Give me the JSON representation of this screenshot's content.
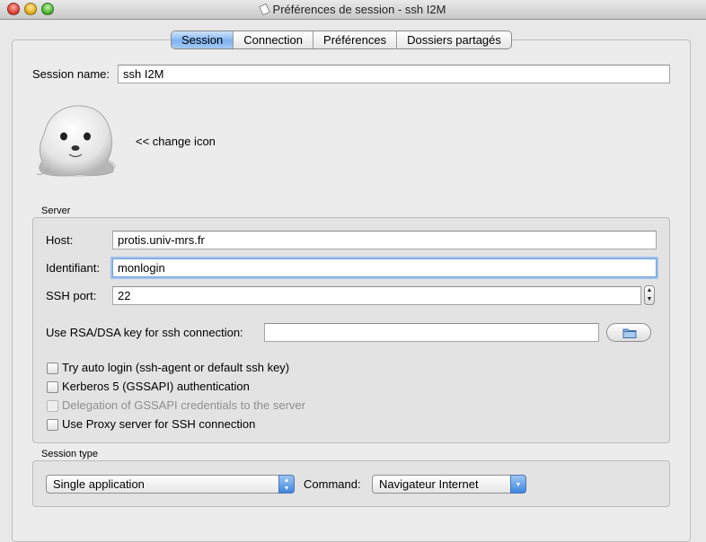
{
  "window": {
    "title": "Préférences de session - ssh I2M"
  },
  "tabs": [
    {
      "label": "Session"
    },
    {
      "label": "Connection"
    },
    {
      "label": "Préférences"
    },
    {
      "label": "Dossiers partagés"
    }
  ],
  "active_tab": "Session",
  "session": {
    "name_label": "Session name:",
    "name_value": "ssh I2M",
    "change_icon_label": "<< change icon",
    "icon": "seal-icon"
  },
  "server": {
    "group_title": "Server",
    "host_label": "Host:",
    "host_value": "protis.univ-mrs.fr",
    "identifiant_label": "Identifiant:",
    "identifiant_value": "monlogin",
    "port_label": "SSH port:",
    "port_value": "22",
    "key_label": "Use RSA/DSA key for ssh connection:",
    "key_value": "",
    "key_browse_icon": "folder-icon",
    "options": [
      {
        "label": "Try auto login (ssh-agent or default ssh key)",
        "checked": false,
        "enabled": true
      },
      {
        "label": "Kerberos 5 (GSSAPI) authentication",
        "checked": false,
        "enabled": true
      },
      {
        "label": "Delegation of GSSAPI credentials to the server",
        "checked": false,
        "enabled": false
      },
      {
        "label": "Use Proxy server for SSH connection",
        "checked": false,
        "enabled": true
      }
    ]
  },
  "session_type": {
    "group_title": "Session type",
    "type_value": "Single application",
    "command_label": "Command:",
    "command_value": "Navigateur Internet"
  },
  "colors": {
    "tab_active": "#7fb3ee",
    "focus_ring": "#9fc3ee",
    "window_bg": "#e8e8e8"
  }
}
